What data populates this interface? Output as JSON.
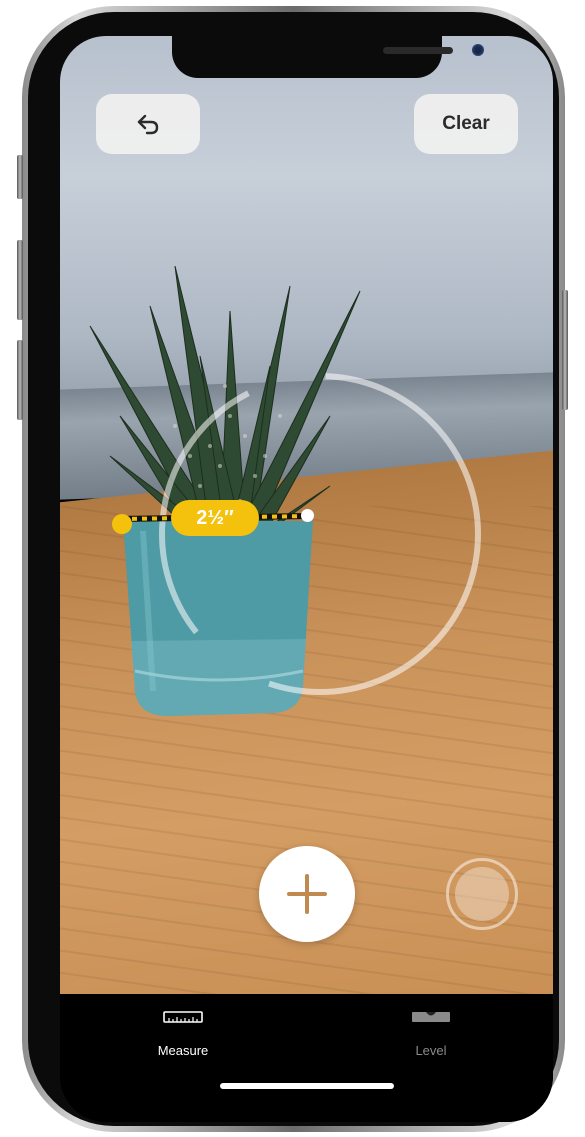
{
  "toolbar": {
    "undo_icon": "undo-arrow-icon",
    "clear_label": "Clear"
  },
  "measurement": {
    "value": "2½″",
    "color": "#f4c20d"
  },
  "controls": {
    "add_icon": "plus-icon",
    "add_color": "#c0894f",
    "capture_icon": "shutter-icon"
  },
  "tabs": [
    {
      "label": "Measure",
      "icon": "ruler-icon",
      "selected": true
    },
    {
      "label": "Level",
      "icon": "level-icon",
      "selected": false
    }
  ]
}
